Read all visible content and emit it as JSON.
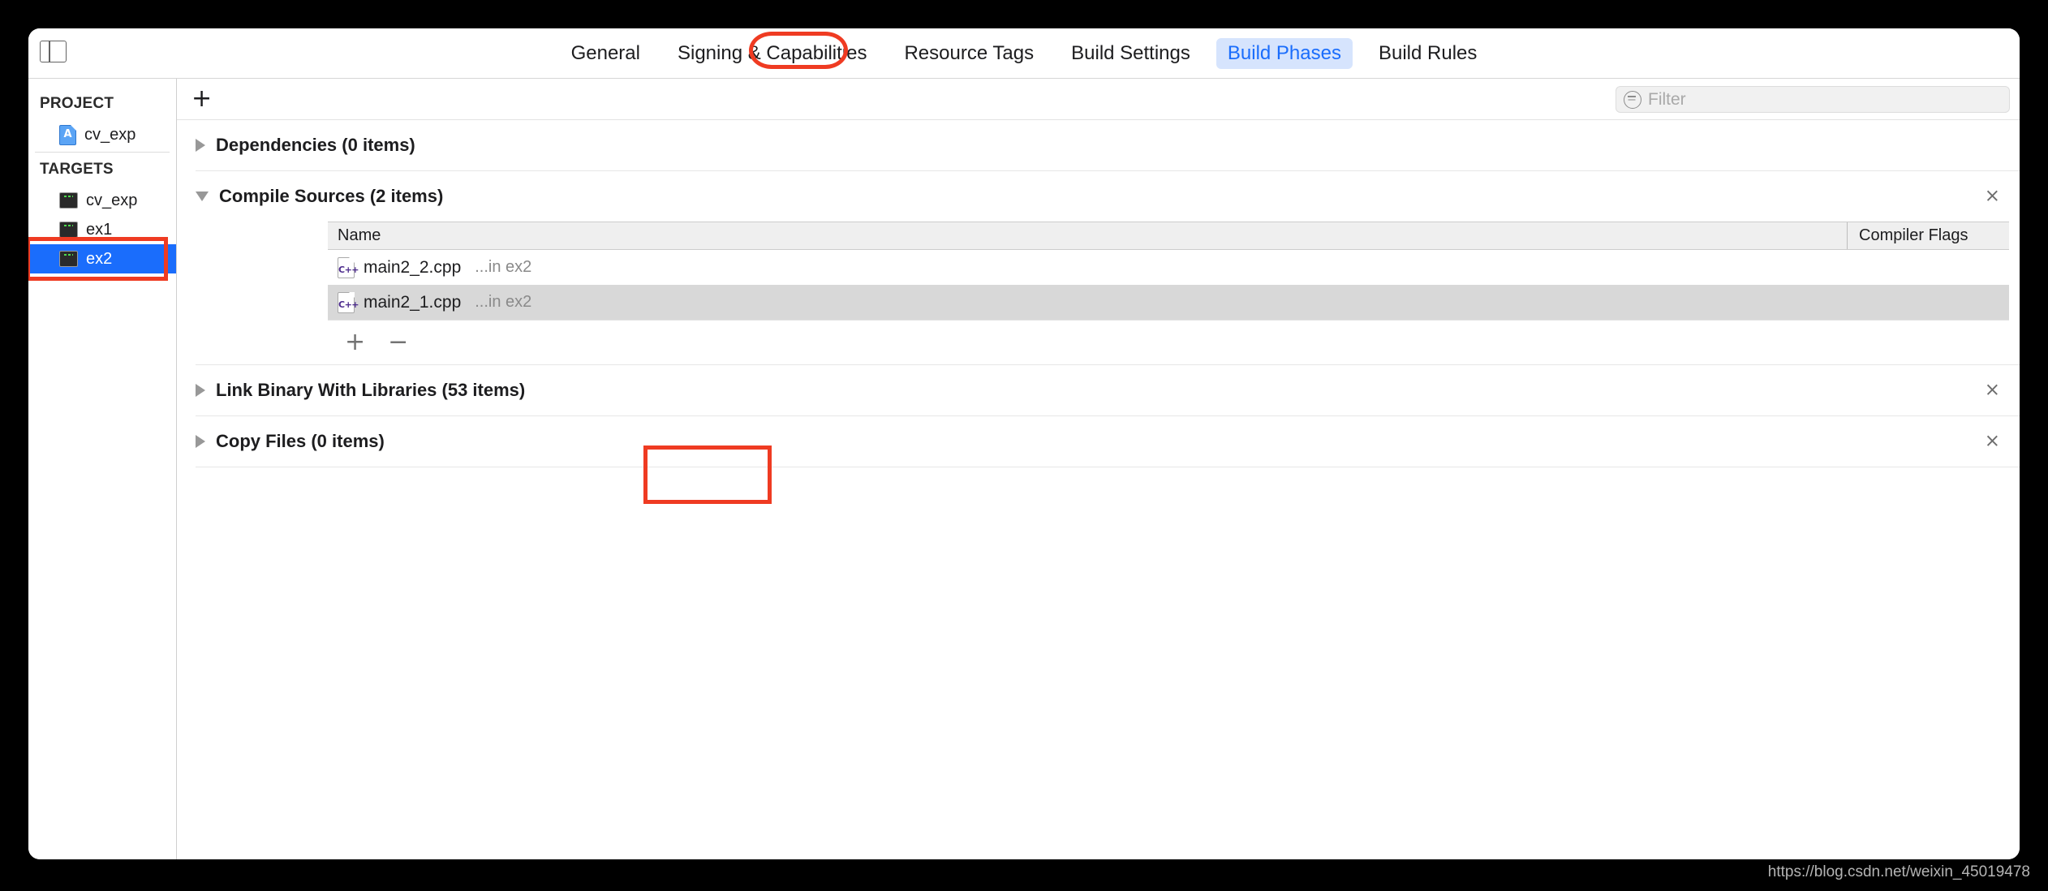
{
  "window": {
    "sidebar_toggle_icon": "sidebar-toggle-icon"
  },
  "tabs": [
    {
      "label": "General",
      "active": false
    },
    {
      "label": "Signing & Capabilities",
      "active": false
    },
    {
      "label": "Resource Tags",
      "active": false
    },
    {
      "label": "Build Settings",
      "active": false
    },
    {
      "label": "Build Phases",
      "active": true
    },
    {
      "label": "Build Rules",
      "active": false
    }
  ],
  "sidebar": {
    "project_group_label": "PROJECT",
    "targets_group_label": "TARGETS",
    "project_items": [
      {
        "label": "cv_exp",
        "icon": "xcode-project-icon"
      }
    ],
    "target_items": [
      {
        "label": "cv_exp",
        "icon": "command-line-tool-icon",
        "selected": false
      },
      {
        "label": "ex1",
        "icon": "command-line-tool-icon",
        "selected": false
      },
      {
        "label": "ex2",
        "icon": "command-line-tool-icon",
        "selected": true
      }
    ]
  },
  "toolbar": {
    "add_phase_label": "+",
    "filter_placeholder": "Filter",
    "filter_value": "",
    "filter_icon": "filter-circle-icon"
  },
  "phases": [
    {
      "title": "Dependencies (0 items)",
      "expanded": false,
      "closable": false
    },
    {
      "title": "Compile Sources (2 items)",
      "expanded": true,
      "closable": true,
      "close_label": "×",
      "table": {
        "columns": [
          "Name",
          "Compiler Flags"
        ],
        "rows": [
          {
            "icon": "cpp-file-icon",
            "icon_label": "C++",
            "name": "main2_2.cpp",
            "location": "...in ex2",
            "compiler_flags": "",
            "selected": false
          },
          {
            "icon": "cpp-file-icon",
            "icon_label": "C++",
            "name": "main2_1.cpp",
            "location": "...in ex2",
            "compiler_flags": "",
            "selected": true
          }
        ]
      },
      "footer": {
        "add_label": "+",
        "remove_label": "−"
      }
    },
    {
      "title": "Link Binary With Libraries (53 items)",
      "expanded": false,
      "closable": true,
      "close_label": "×"
    },
    {
      "title": "Copy Files (0 items)",
      "expanded": false,
      "closable": true,
      "close_label": "×"
    }
  ],
  "annotations": {
    "accent_color": "#ef3b22",
    "tab_highlight": "build-phases-tab",
    "sidebar_highlight": "target-ex2",
    "footer_highlight": "add-remove-buttons"
  },
  "watermark": {
    "text": "https://blog.csdn.net/weixin_45019478"
  },
  "colors": {
    "selection_blue": "#1a6dfc",
    "tab_pill": "#d6e4fd",
    "row_selected_gray": "#d8d8d8",
    "desktop": "#000000"
  }
}
